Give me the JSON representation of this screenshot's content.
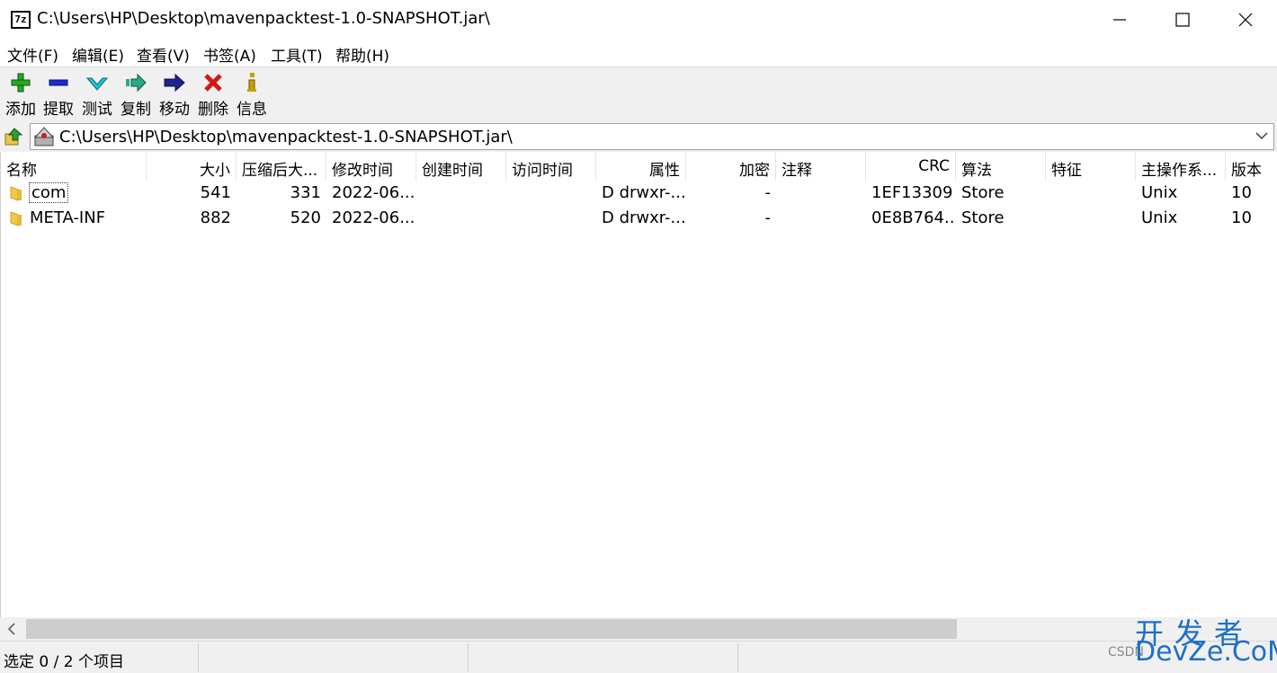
{
  "window": {
    "app_icon_text": "7z",
    "title": "C:\\Users\\HP\\Desktop\\mavenpacktest-1.0-SNAPSHOT.jar\\"
  },
  "menu": [
    "文件(F)",
    "编辑(E)",
    "查看(V)",
    "书签(A)",
    "工具(T)",
    "帮助(H)"
  ],
  "toolbar": [
    {
      "label": "添加",
      "icon": "plus-icon",
      "color": "#22aa22"
    },
    {
      "label": "提取",
      "icon": "minus-icon",
      "color": "#1a2bd4"
    },
    {
      "label": "测试",
      "icon": "check-chevron-icon",
      "color": "#1fc6d6"
    },
    {
      "label": "复制",
      "icon": "copy-arrow-icon",
      "color": "#2aa88c"
    },
    {
      "label": "移动",
      "icon": "move-arrow-icon",
      "color": "#1a2590"
    },
    {
      "label": "删除",
      "icon": "delete-x-icon",
      "color": "#d11a1a"
    },
    {
      "label": "信息",
      "icon": "info-icon",
      "color": "#c9a000"
    }
  ],
  "address": {
    "path": "C:\\Users\\HP\\Desktop\\mavenpacktest-1.0-SNAPSHOT.jar\\"
  },
  "columns": [
    "名称",
    "大小",
    "压缩后大...",
    "修改时间",
    "创建时间",
    "访问时间",
    "属性",
    "加密",
    "注释",
    "CRC",
    "算法",
    "特征",
    "主操作系...",
    "版本"
  ],
  "rows": [
    {
      "name": "com",
      "size": "541",
      "packed": "331",
      "modified": "2022-06...",
      "created": "",
      "accessed": "",
      "attributes": "D drwxr-...",
      "encrypted": "-",
      "comment": "",
      "crc": "1EF13309",
      "method": "Store",
      "characteristics": "",
      "host_os": "Unix",
      "version": "10"
    },
    {
      "name": "META-INF",
      "size": "882",
      "packed": "520",
      "modified": "2022-06...",
      "created": "",
      "accessed": "",
      "attributes": "D drwxr-...",
      "encrypted": "-",
      "comment": "",
      "crc": "0E8B764...",
      "method": "Store",
      "characteristics": "",
      "host_os": "Unix",
      "version": "10"
    }
  ],
  "status": {
    "selection": "选定 0 / 2 个项目"
  },
  "watermark": {
    "line1": "开发者",
    "line2": "CSDN",
    "line3": "DevZe.CoM"
  }
}
